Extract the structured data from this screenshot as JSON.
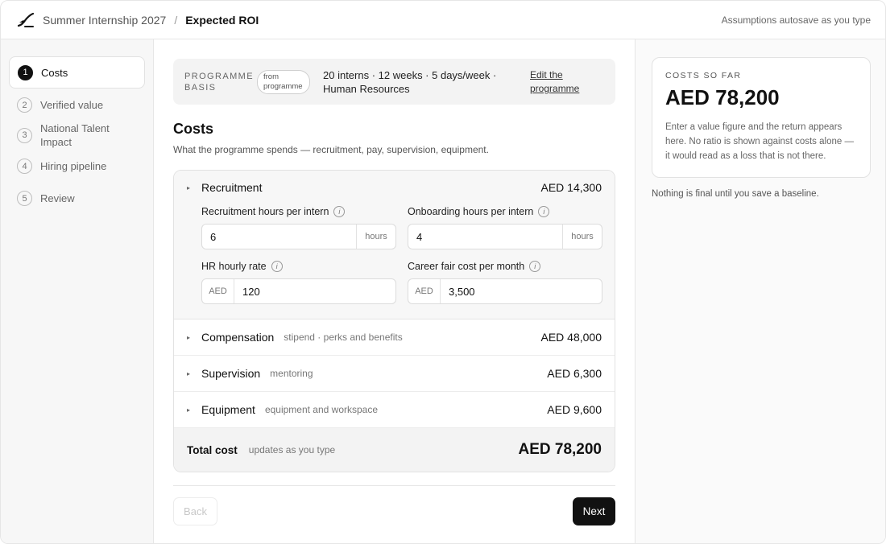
{
  "header": {
    "project": "Summer Internship 2027",
    "separator": "/",
    "page": "Expected ROI",
    "status": "Assumptions autosave as you type"
  },
  "steps": [
    {
      "num": "1",
      "label": "Costs",
      "active": true
    },
    {
      "num": "2",
      "label": "Verified value",
      "active": false
    },
    {
      "num": "3",
      "label": "National Talent Impact",
      "active": false
    },
    {
      "num": "4",
      "label": "Hiring pipeline",
      "active": false
    },
    {
      "num": "5",
      "label": "Review",
      "active": false
    }
  ],
  "basis": {
    "label": "PROGRAMME BASIS",
    "pill": "from programme",
    "text": "20 interns · 12 weeks · 5 days/week · Human Resources",
    "link": "Edit the programme"
  },
  "costs": {
    "title": "Costs",
    "subtitle": "What the programme spends — recruitment, pay, supervision, equipment.",
    "recruitment": {
      "title": "Recruitment",
      "amount": "AED 14,300",
      "fields": [
        {
          "label": "Recruitment hours per intern",
          "value": "6",
          "unit": "hours"
        },
        {
          "label": "Onboarding hours per intern",
          "value": "4",
          "unit": "hours"
        },
        {
          "label": "HR hourly rate",
          "value": "120",
          "currency": "AED"
        },
        {
          "label": "Career fair cost per month",
          "value": "3,500",
          "currency": "AED"
        }
      ]
    },
    "rows": [
      {
        "title": "Compensation",
        "note": "stipend · perks and benefits",
        "amount": "AED 48,000"
      },
      {
        "title": "Supervision",
        "note": "mentoring",
        "amount": "AED 6,300"
      },
      {
        "title": "Equipment",
        "note": "equipment and workspace",
        "amount": "AED 9,600"
      }
    ],
    "total": {
      "title": "Total cost",
      "note": "updates as you type",
      "amount": "AED 78,200"
    }
  },
  "nav": {
    "back": "Back",
    "next": "Next"
  },
  "summary": {
    "label": "COSTS SO FAR",
    "amount": "AED 78,200",
    "note": "Enter a value figure and the return appears here. No ratio is shown against costs alone — it would read as a loss that is not there.",
    "final_note": "Nothing is final until you save a baseline."
  },
  "icons": {
    "caret": "▸",
    "info": "i"
  }
}
